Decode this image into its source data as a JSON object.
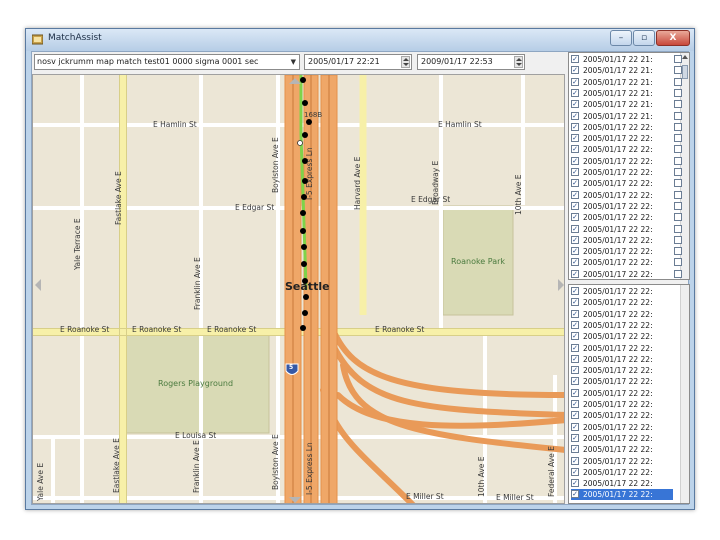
{
  "window": {
    "title": "MatchAssist",
    "minimize_glyph": "–",
    "maximize_glyph": "▫",
    "close_glyph": "X"
  },
  "toolbar": {
    "dataset": "nosv jckrumm map match test01 0000 sigma 0001 sec",
    "start_time": "2005/01/17 22:21",
    "end_time": "2009/01/17 22:53"
  },
  "map": {
    "streets": [
      "E Hamlin St",
      "E Hamlin St",
      "E Edgar St",
      "E Edgar St",
      "E Roanoke St",
      "E Roanoke St",
      "E Roanoke St",
      "E Roanoke St",
      "E Louisa St",
      "E Miller St",
      "E Miller St"
    ],
    "avenues": [
      "Fastlake Ave E",
      "Yale Terrace E",
      "Franklin Ave E",
      "Boylston Ave E",
      "I-5 Express Ln",
      "Harvard Ave E",
      "Broadway E",
      "10th Ave E",
      "Yale Ave E",
      "Eastlake Ave E",
      "Franklin Ave E",
      "Boylston Ave E",
      "I-5 Express Ln",
      "10th Ave E",
      "Federal Ave E"
    ],
    "parks": [
      "Roanoke Park",
      "Rogers Playground"
    ],
    "city": "Seattle",
    "shield": "5",
    "exit_label": "168B"
  },
  "list_top": {
    "rows": [
      "2005/01/17 22 21:",
      "2005/01/17 22 21:",
      "2005/01/17 22 21:",
      "2005/01/17 22 21:",
      "2005/01/17 22 21:",
      "2005/01/17 22 21:",
      "2005/01/17 22 22:",
      "2005/01/17 22 22:",
      "2005/01/17 22 22:",
      "2005/01/17 22 22:",
      "2005/01/17 22 22:",
      "2005/01/17 22 22:",
      "2005/01/17 22 22:",
      "2005/01/17 22 22:",
      "2005/01/17 22 22:",
      "2005/01/17 22 22:",
      "2005/01/17 22 22:",
      "2005/01/17 22 22:",
      "2005/01/17 22 22:",
      "2005/01/17 22 22:"
    ]
  },
  "list_bottom": {
    "rows": [
      "2005/01/17 22 22:",
      "2005/01/17 22 22:",
      "2005/01/17 22 22:",
      "2005/01/17 22 22:",
      "2005/01/17 22 22:",
      "2005/01/17 22 22:",
      "2005/01/17 22 22:",
      "2005/01/17 22 22:",
      "2005/01/17 22 22:",
      "2005/01/17 22 22:",
      "2005/01/17 22 22:",
      "2005/01/17 22 22:",
      "2005/01/17 22 22:",
      "2005/01/17 22 22:",
      "2005/01/17 22 22:",
      "2005/01/17 22 22:",
      "2005/01/17 22 22:",
      "2005/01/17 22 22:",
      "2005/01/17 22 22:"
    ]
  },
  "colors": {
    "freeway": "#e89a5a",
    "arterial": "#f6efa6",
    "park": "#d8d9b4",
    "route": "#7fd34a",
    "point": "#000000"
  }
}
